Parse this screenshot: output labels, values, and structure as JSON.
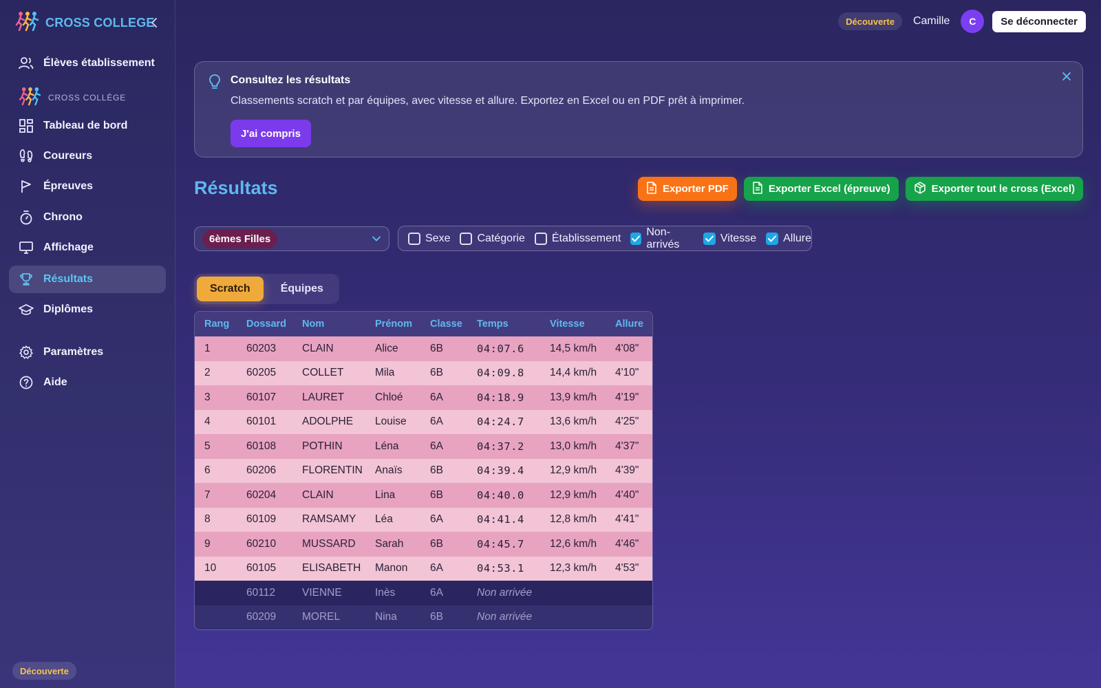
{
  "app": {
    "brand": "CROSS COLLEGE",
    "section_label": "CROSS COLLÈGE"
  },
  "topbar": {
    "mode_badge": "Découverte",
    "user_name": "Camille",
    "avatar_initial": "C",
    "logout_label": "Se déconnecter"
  },
  "sidebar": {
    "items": [
      {
        "label": "Élèves établissement",
        "icon": "users-icon"
      },
      {
        "label": "Tableau de bord",
        "icon": "dashboard-icon"
      },
      {
        "label": "Coureurs",
        "icon": "footprints-icon"
      },
      {
        "label": "Épreuves",
        "icon": "flag-icon"
      },
      {
        "label": "Chrono",
        "icon": "stopwatch-icon"
      },
      {
        "label": "Affichage",
        "icon": "monitor-icon"
      },
      {
        "label": "Résultats",
        "icon": "trophy-icon",
        "active": true
      },
      {
        "label": "Diplômes",
        "icon": "graduation-cap-icon"
      },
      {
        "label": "Paramètres",
        "icon": "gear-icon"
      },
      {
        "label": "Aide",
        "icon": "help-icon"
      }
    ],
    "mode_badge": "Découverte"
  },
  "banner": {
    "title": "Consultez les résultats",
    "text": "Classements scratch et par équipes, avec vitesse et allure. Exportez en Excel ou en PDF prêt à imprimer.",
    "button_label": "J'ai compris"
  },
  "page": {
    "title": "Résultats",
    "exports": {
      "pdf": "Exporter PDF",
      "excel_event": "Exporter Excel (épreuve)",
      "excel_all": "Exporter tout le cross (Excel)"
    }
  },
  "filters": {
    "selected_event": "6èmes Filles",
    "columns": [
      {
        "label": "Sexe",
        "checked": false
      },
      {
        "label": "Catégorie",
        "checked": false
      },
      {
        "label": "Établissement",
        "checked": false
      },
      {
        "label": "Non-arrivés",
        "checked": true
      },
      {
        "label": "Vitesse",
        "checked": true
      },
      {
        "label": "Allure",
        "checked": true
      }
    ]
  },
  "tabs": [
    {
      "label": "Scratch",
      "active": true
    },
    {
      "label": "Équipes",
      "active": false
    }
  ],
  "table": {
    "headers": [
      "Rang",
      "Dossard",
      "Nom",
      "Prénom",
      "Classe",
      "Temps",
      "Vitesse",
      "Allure"
    ],
    "rows": [
      [
        "1",
        "60203",
        "CLAIN",
        "Alice",
        "6B",
        "04:07.6",
        "14,5 km/h",
        "4'08\""
      ],
      [
        "2",
        "60205",
        "COLLET",
        "Mila",
        "6B",
        "04:09.8",
        "14,4 km/h",
        "4'10\""
      ],
      [
        "3",
        "60107",
        "LAURET",
        "Chloé",
        "6A",
        "04:18.9",
        "13,9 km/h",
        "4'19\""
      ],
      [
        "4",
        "60101",
        "ADOLPHE",
        "Louise",
        "6A",
        "04:24.7",
        "13,6 km/h",
        "4'25\""
      ],
      [
        "5",
        "60108",
        "POTHIN",
        "Léna",
        "6A",
        "04:37.2",
        "13,0 km/h",
        "4'37\""
      ],
      [
        "6",
        "60206",
        "FLORENTIN",
        "Anaïs",
        "6B",
        "04:39.4",
        "12,9 km/h",
        "4'39\""
      ],
      [
        "7",
        "60204",
        "CLAIN",
        "Lina",
        "6B",
        "04:40.0",
        "12,9 km/h",
        "4'40\""
      ],
      [
        "8",
        "60109",
        "RAMSAMY",
        "Léa",
        "6A",
        "04:41.4",
        "12,8 km/h",
        "4'41\""
      ],
      [
        "9",
        "60210",
        "MUSSARD",
        "Sarah",
        "6B",
        "04:45.7",
        "12,6 km/h",
        "4'46\""
      ],
      [
        "10",
        "60105",
        "ELISABETH",
        "Manon",
        "6A",
        "04:53.1",
        "12,3 km/h",
        "4'53\""
      ],
      [
        "",
        "60112",
        "VIENNE",
        "Inès",
        "6A",
        "Non arrivée",
        "",
        ""
      ],
      [
        "",
        "60209",
        "MOREL",
        "Nina",
        "6B",
        "Non arrivée",
        "",
        ""
      ]
    ]
  },
  "colors": {
    "accent_blue": "#5fb8f0",
    "purple": "#7c3aed",
    "orange": "#f97316",
    "green": "#16a34a",
    "gold": "#f0a93b"
  }
}
